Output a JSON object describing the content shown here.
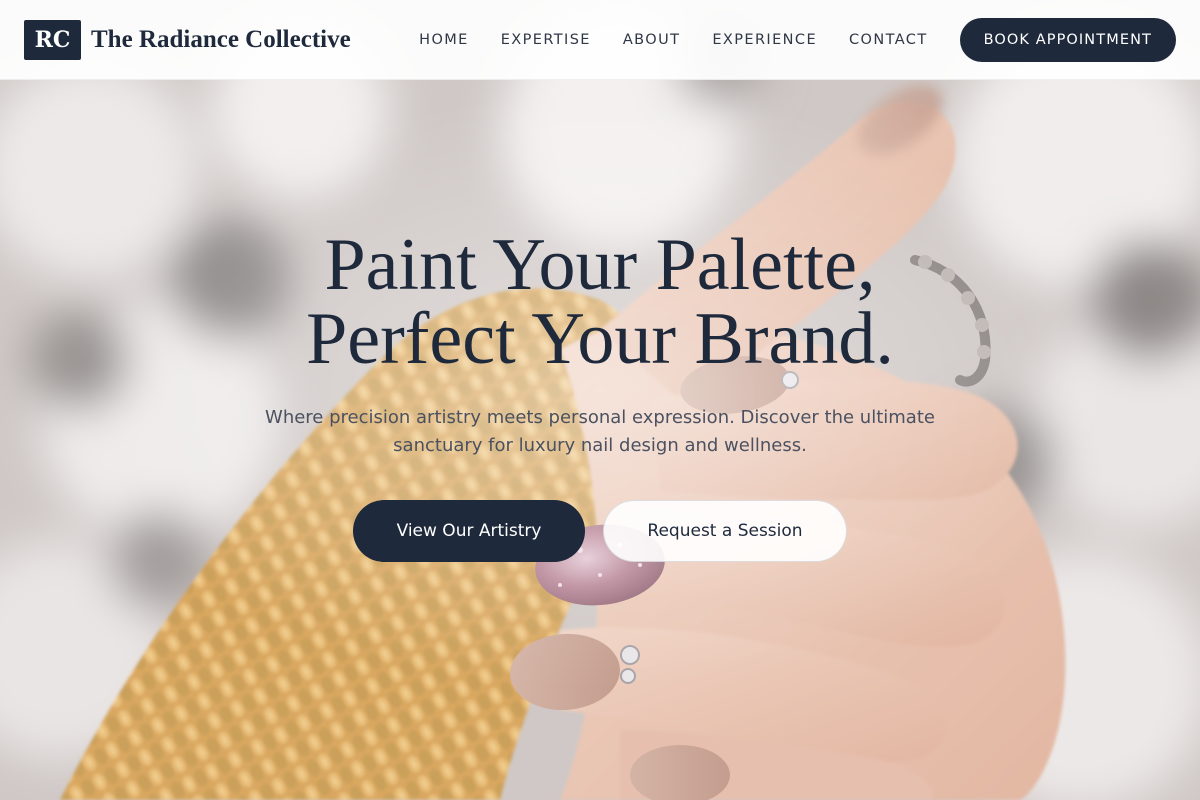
{
  "brand": {
    "logo_text": "RC",
    "name": "The Radiance Collective"
  },
  "nav": {
    "items": [
      {
        "label": "HOME"
      },
      {
        "label": "EXPERTISE"
      },
      {
        "label": "ABOUT"
      },
      {
        "label": "EXPERIENCE"
      },
      {
        "label": "CONTACT"
      }
    ],
    "cta_label": "BOOK APPOINTMENT"
  },
  "hero": {
    "title_line1": "Paint Your Palette,",
    "title_line2": "Perfect Your Brand.",
    "subtitle": "Where precision artistry meets personal expression. Discover the ultimate sanctuary for luxury nail design and wellness.",
    "primary_cta": "View Our Artistry",
    "secondary_cta": "Request a Session",
    "background_image": "hand-with-manicured-nails-and-knit-sweater"
  },
  "colors": {
    "navy": "#1e293b",
    "header_bg": "#ffffff",
    "subtitle_text": "#4b5160"
  }
}
